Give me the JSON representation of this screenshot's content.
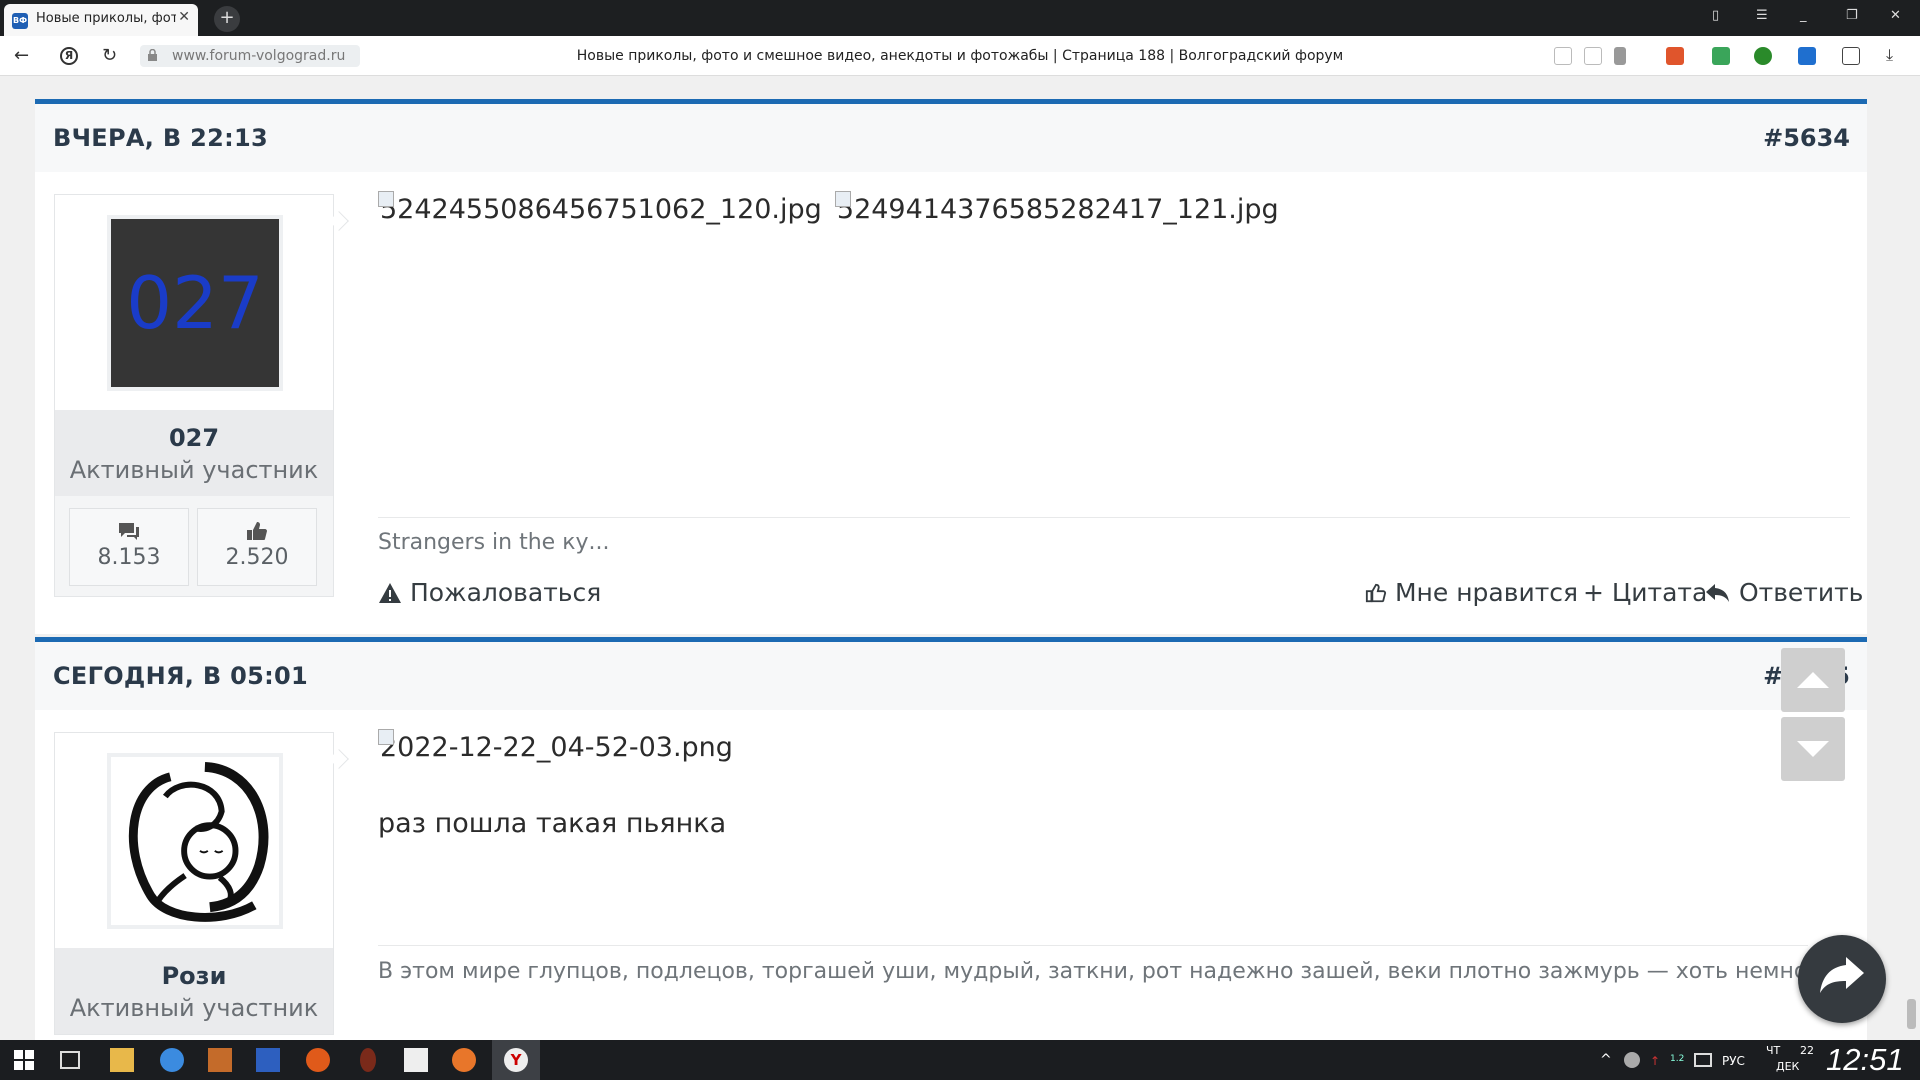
{
  "browser": {
    "tab_title": "Новые приколы, фото",
    "tab_favicon": "ВФ",
    "url": "www.forum-volgograd.ru",
    "page_title": "Новые приколы, фото и смешное видео, анекдоты и фотожабы | Страница 188 | Волгоградский форум"
  },
  "posts": [
    {
      "date": "ВЧЕРА, В 22:13",
      "number": "#5634",
      "author": {
        "avatar_text": "027",
        "name": "027",
        "role": "Активный участник",
        "messages": "8.153",
        "likes": "2.520"
      },
      "images": [
        "5242455086456751062_120.jpg",
        "5249414376585282417_121.jpg"
      ],
      "text": "",
      "signature": "Strangers in the ку...",
      "actions": {
        "report": "Пожаловаться",
        "like": "Мне нравится",
        "quote": "+ Цитата",
        "reply": "Ответить"
      }
    },
    {
      "date": "СЕГОДНЯ, В 05:01",
      "number": "#5635",
      "author": {
        "name": "Рози",
        "role": "Активный участник"
      },
      "images": [
        "2022-12-22_04-52-03.png"
      ],
      "text": "раз пошла такая пьянка",
      "signature": "В этом мире глупцов, подлецов, торгашей уши, мудрый, заткни, рот надежно зашей, веки плотно зажмурь — хоть немного"
    }
  ],
  "taskbar": {
    "lang": "РУС",
    "day": "ЧТ",
    "date_num": "22",
    "month": "ДЕК",
    "time": "12:51",
    "tray_small": "1.2"
  },
  "colors": {
    "accent": "#1c6ab3",
    "heading": "#2b3a4a"
  }
}
